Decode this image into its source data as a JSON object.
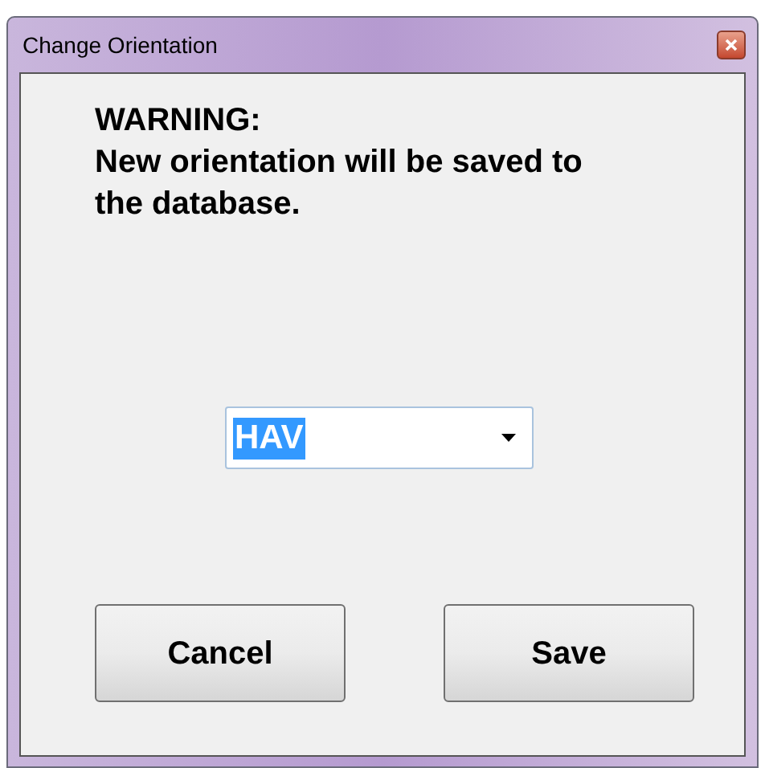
{
  "window": {
    "title": "Change Orientation"
  },
  "warning": {
    "heading": "WARNING:",
    "message": "New orientation will be saved to the database."
  },
  "orientation_select": {
    "value": "HAV",
    "text_selected": true
  },
  "buttons": [
    {
      "label": "Cancel"
    },
    {
      "label": "Save"
    }
  ]
}
